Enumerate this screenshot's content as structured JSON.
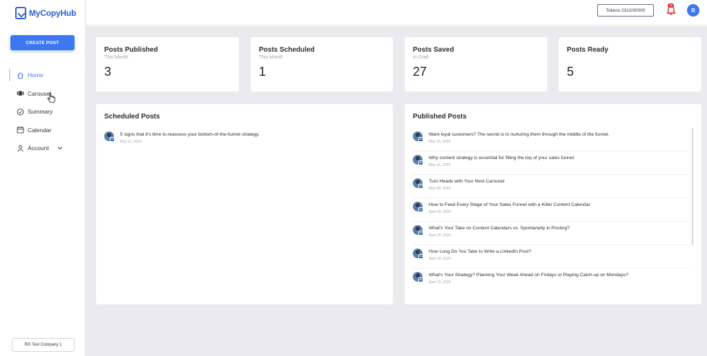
{
  "brand": {
    "name": "MyCopyHub"
  },
  "sidebar": {
    "create_label": "CREATE POST",
    "items": [
      {
        "label": "Home",
        "icon": "home-icon",
        "active": true
      },
      {
        "label": "Carousel",
        "icon": "carousel-icon"
      },
      {
        "label": "Summary",
        "icon": "summary-icon"
      },
      {
        "label": "Calendar",
        "icon": "calendar-icon"
      },
      {
        "label": "Account",
        "icon": "user-icon"
      }
    ],
    "company_label": "RG Test Company 1"
  },
  "header": {
    "tokens_label": "Tokens 2312/30000",
    "notification_count": "25",
    "avatar_initial": "R"
  },
  "colors": {
    "accent": "#3d78f2",
    "badge": "#e02424",
    "background": "#ebebef"
  },
  "stats": [
    {
      "title": "Posts Published",
      "subtitle": "This Month",
      "value": "3"
    },
    {
      "title": "Posts Scheduled",
      "subtitle": "This Month",
      "value": "1"
    },
    {
      "title": "Posts Saved",
      "subtitle": "In Draft",
      "value": "27"
    },
    {
      "title": "Posts Ready",
      "subtitle": "",
      "value": "5"
    }
  ],
  "scheduled": {
    "title": "Scheduled Posts",
    "posts": [
      {
        "text": "5 signs that it's time to reassess your bottom-of-the-funnel strategy.",
        "date": "May 11, 2024"
      }
    ]
  },
  "published": {
    "title": "Published Posts",
    "posts": [
      {
        "text": "Want loyal customers? The secret is in nurturing them through the middle of the funnel.",
        "date": "May 16, 2024"
      },
      {
        "text": "Why content strategy is essential for filling the top of your sales funnel.",
        "date": "May 15, 2024"
      },
      {
        "text": "Turn Heads with Your Next Carousel",
        "date": "May 08, 2024"
      },
      {
        "text": "How to Feed Every Stage of Your Sales Funnel with a Killer Content Calendar",
        "date": "April 29, 2024"
      },
      {
        "text": "What's Your Take on Content Calendars vs. Spontaneity in Posting?",
        "date": "April 25, 2024"
      },
      {
        "text": "How Long Do You Take to Write a LinkedIn Post?",
        "date": "April 23, 2024"
      },
      {
        "text": "What's Your Strategy? Planning Your Week Ahead on Fridays or Playing Catch-up on Mondays?",
        "date": "April 22, 2024"
      }
    ]
  }
}
